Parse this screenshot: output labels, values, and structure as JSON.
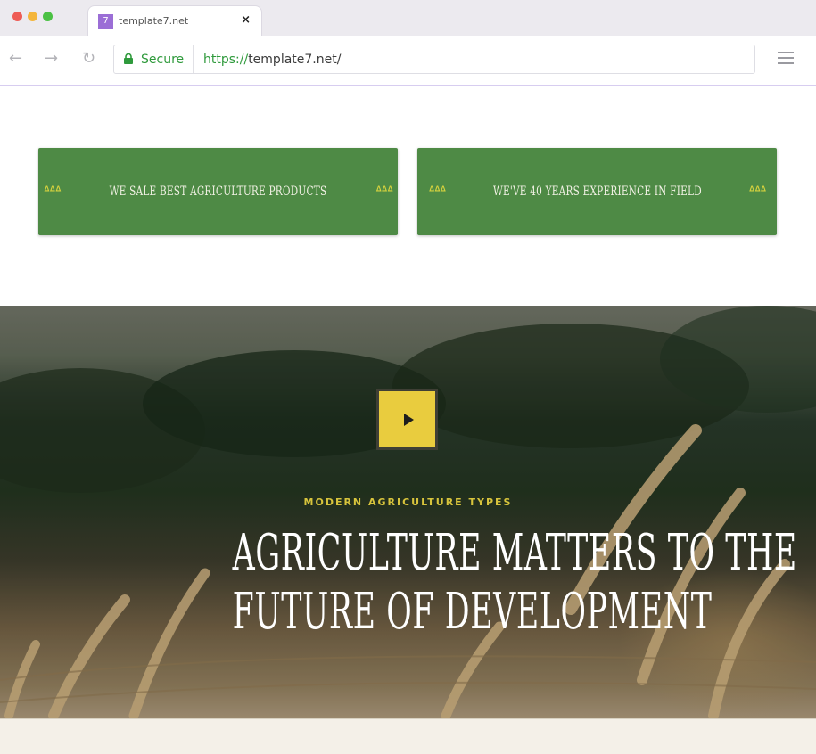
{
  "browser": {
    "tab": {
      "favicon": "7",
      "title": "template7.net",
      "close": "×"
    },
    "nav": {
      "back": "←",
      "forward": "→",
      "reload": "↻"
    },
    "address": {
      "secure_label": "Secure",
      "url_protocol": "https://",
      "url_rest": "template7.net/"
    }
  },
  "banners": [
    {
      "icon": "ᐞᐞᐞ",
      "text": "WE SALE BEST AGRICULTURE PRODUCTS"
    },
    {
      "icon": "ᐞᐞᐞ",
      "text": "WE'VE 40 YEARS EXPERIENCE IN FIELD"
    }
  ],
  "hero": {
    "kicker": "MODERN AGRICULTURE TYPES",
    "title_line1": "AGRICULTURE MATTERS TO THE",
    "title_line2": "FUTURE OF DEVELOPMENT"
  },
  "colors": {
    "brand_green": "#4e8a45",
    "accent_yellow": "#e9cc3e",
    "secure_green": "#2f9a3c"
  }
}
